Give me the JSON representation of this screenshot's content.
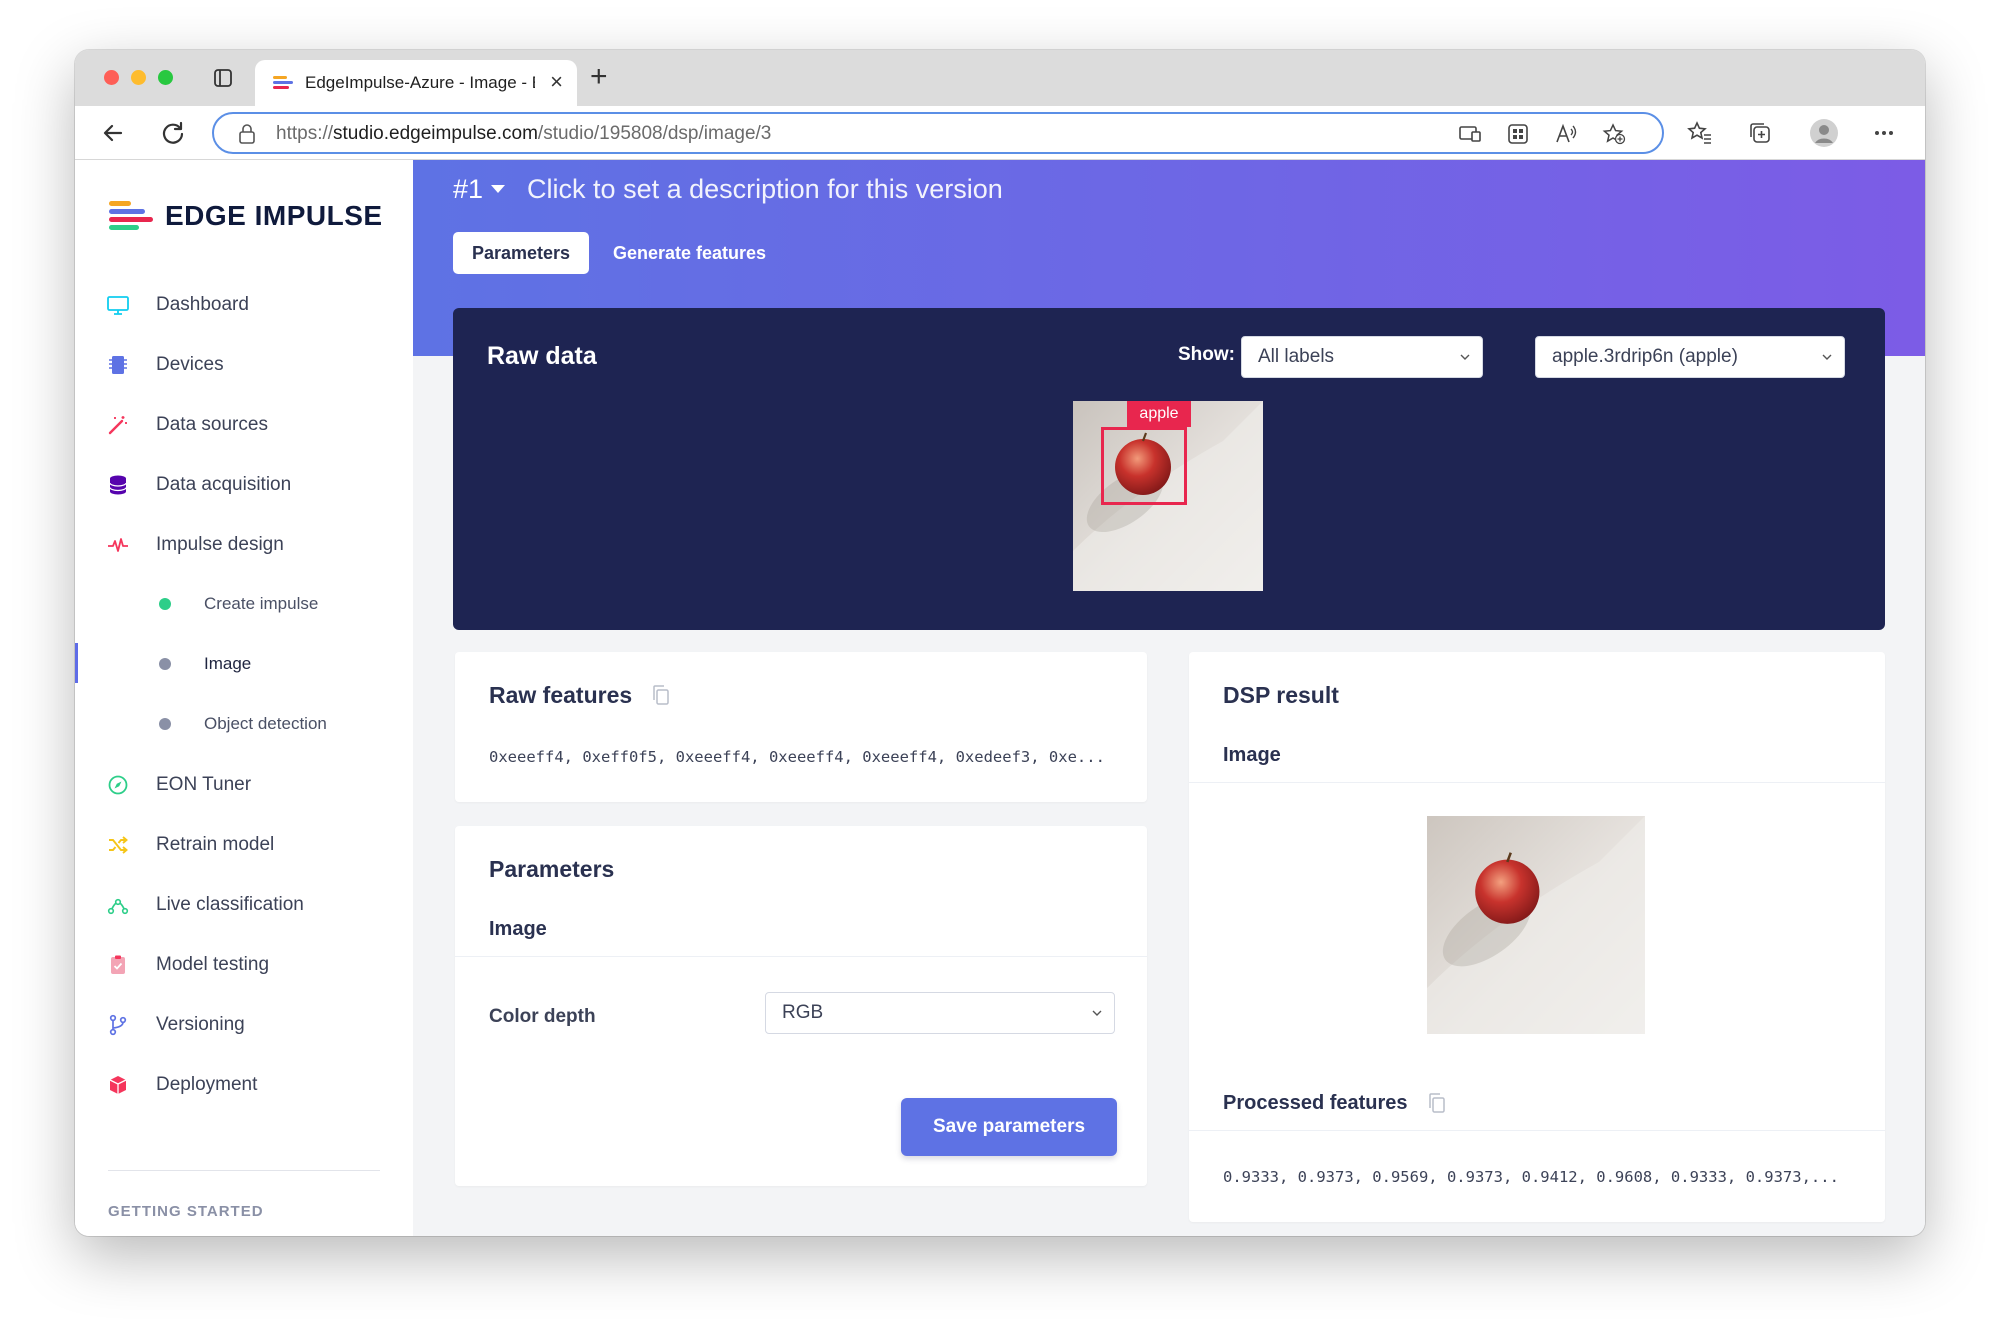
{
  "browser": {
    "tab_title": "EdgeImpulse-Azure - Image - E",
    "url_scheme": "https://",
    "url_host": "studio.edgeimpulse.com",
    "url_path": "/studio/195808/dsp/image/3"
  },
  "sidebar": {
    "logo_text": "EDGE IMPULSE",
    "items": [
      {
        "label": "Dashboard",
        "icon": "monitor-icon"
      },
      {
        "label": "Devices",
        "icon": "chip-icon"
      },
      {
        "label": "Data sources",
        "icon": "wand-icon"
      },
      {
        "label": "Data acquisition",
        "icon": "database-icon"
      },
      {
        "label": "Impulse design",
        "icon": "pulse-icon"
      },
      {
        "label": "Create impulse",
        "icon": "dot-green"
      },
      {
        "label": "Image",
        "icon": "dot-gray",
        "active": true
      },
      {
        "label": "Object detection",
        "icon": "dot-gray"
      },
      {
        "label": "EON Tuner",
        "icon": "compass-icon"
      },
      {
        "label": "Retrain model",
        "icon": "shuffle-icon"
      },
      {
        "label": "Live classification",
        "icon": "nodes-icon"
      },
      {
        "label": "Model testing",
        "icon": "clipboard-icon"
      },
      {
        "label": "Versioning",
        "icon": "branch-icon"
      },
      {
        "label": "Deployment",
        "icon": "box-icon"
      }
    ],
    "getting_started": "GETTING STARTED"
  },
  "header": {
    "version": "#1",
    "version_description": "Click to set a description for this version",
    "tabs": [
      "Parameters",
      "Generate features"
    ]
  },
  "raw_data": {
    "title": "Raw data",
    "show_label": "Show:",
    "label_filter": "All labels",
    "sample": "apple.3rdrip6n (apple)",
    "bbox_label": "apple"
  },
  "raw_features": {
    "title": "Raw features",
    "values": "0xeeeff4, 0xeff0f5, 0xeeeff4, 0xeeeff4, 0xeeeff4, 0xedeef3, 0xe..."
  },
  "parameters": {
    "title": "Parameters",
    "section": "Image",
    "color_depth_label": "Color depth",
    "color_depth_value": "RGB",
    "save_button": "Save parameters"
  },
  "dsp_result": {
    "title": "DSP result",
    "section": "Image",
    "processed_title": "Processed features",
    "processed_values": "0.9333, 0.9373, 0.9569, 0.9373, 0.9412, 0.9608, 0.9333, 0.9373,..."
  },
  "colors": {
    "accent": "#5e72e4",
    "hero_end": "#7c5ce6",
    "rawdata_bg": "#1e2452",
    "bbox": "#e8264e"
  }
}
